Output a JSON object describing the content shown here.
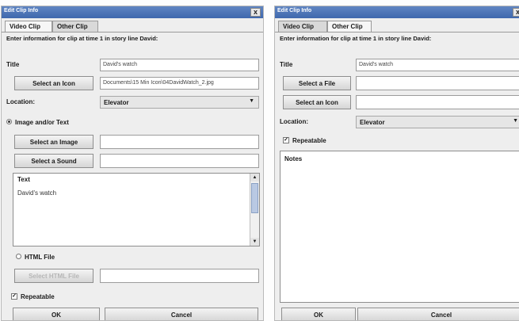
{
  "left_dialog": {
    "title": "Edit Clip Info",
    "close_glyph": "x",
    "tabs": [
      {
        "label": "Video Clip"
      },
      {
        "label": "Other Clip"
      }
    ],
    "info_text": "Enter information for clip at time 1 in story line David:",
    "title_label": "Title",
    "title_value": "David's watch",
    "select_icon_button": "Select an Icon",
    "icon_path": "Documents\\15 Min Icon\\04DavidWatch_2.jpg",
    "location_label": "Location:",
    "location_value": "Elevator",
    "image_text_option": "Image and/or Text",
    "select_image_button": "Select an Image",
    "select_sound_button": "Select a Sound",
    "text_panel_title": "Text",
    "text_panel_value": "David's watch",
    "html_file_option": "HTML File",
    "select_html_button": "Select HTML File",
    "repeatable_label": "Repeatable",
    "ok_button": "OK",
    "cancel_button": "Cancel"
  },
  "right_dialog": {
    "title": "Edit Clip Info",
    "close_glyph": "x",
    "tabs": [
      {
        "label": "Video Clip"
      },
      {
        "label": "Other Clip"
      }
    ],
    "info_text": "Enter information for clip at time 1 in story line David:",
    "title_label": "Title",
    "title_value": "David's watch",
    "select_file_button": "Select a File",
    "select_icon_button": "Select an Icon",
    "location_label": "Location:",
    "location_value": "Elevator",
    "repeatable_label": "Repeatable",
    "notes_label": "Notes",
    "ok_button": "OK",
    "cancel_button": "Cancel"
  },
  "icons": {
    "dropdown": "chevron-down-icon",
    "check": "checkmark-icon",
    "radio": "radio-icon",
    "scroll_up": "arrow-up-icon",
    "scroll_down": "arrow-down-icon"
  },
  "colors": {
    "titlebar": "#4a72b5",
    "dialog_bg": "#eeeeee",
    "field_bg": "#ffffff"
  }
}
